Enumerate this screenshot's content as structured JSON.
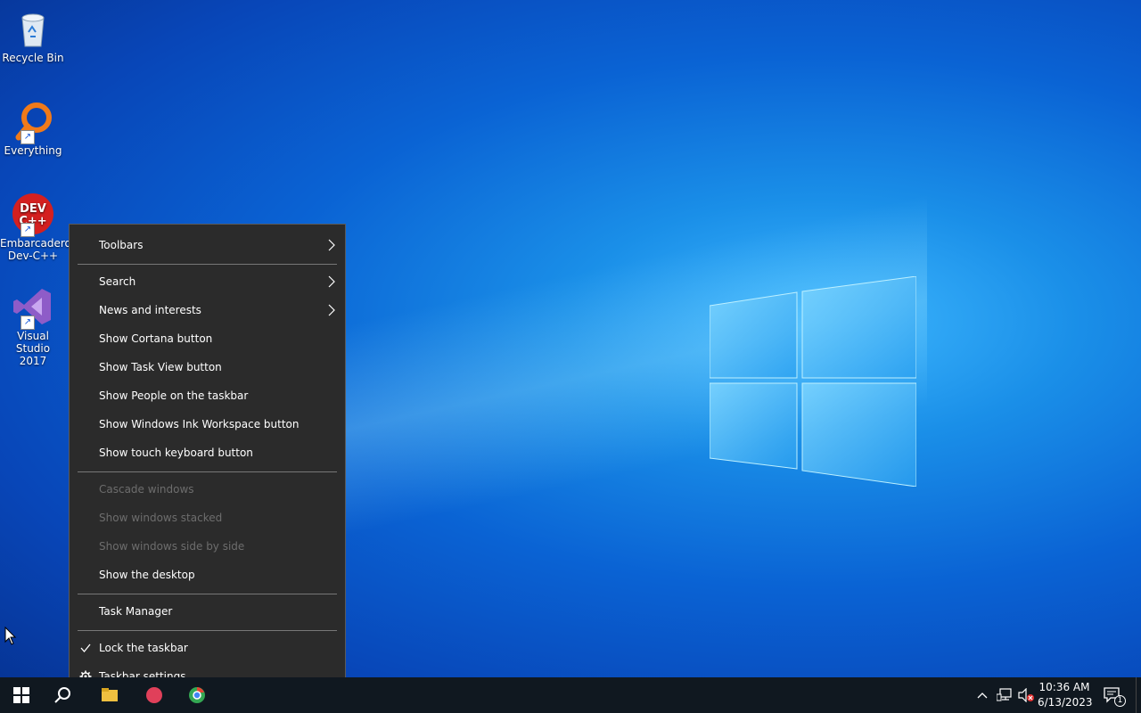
{
  "desktop_icons": [
    {
      "label": "Recycle Bin",
      "icon": "recycle-bin-icon"
    },
    {
      "label": "Everything",
      "icon": "everything-search-icon"
    },
    {
      "label_line1": "Embarcadero",
      "label_line2": "Dev-C++",
      "icon_text_1": "DEV",
      "icon_text_2": "C++",
      "icon": "dev-cpp-icon"
    },
    {
      "label_line1": "Visual Studio",
      "label_line2": "2017",
      "icon": "visual-studio-icon"
    }
  ],
  "context_menu": {
    "items": [
      {
        "label": "Toolbars",
        "submenu": true,
        "enabled": true
      },
      {
        "label": "Search",
        "submenu": true,
        "enabled": true
      },
      {
        "label": "News and interests",
        "submenu": true,
        "enabled": true
      },
      {
        "label": "Show Cortana button",
        "enabled": true
      },
      {
        "label": "Show Task View button",
        "enabled": true
      },
      {
        "label": "Show People on the taskbar",
        "enabled": true
      },
      {
        "label": "Show Windows Ink Workspace button",
        "enabled": true
      },
      {
        "label": "Show touch keyboard button",
        "enabled": true
      },
      {
        "label": "Cascade windows",
        "enabled": false
      },
      {
        "label": "Show windows stacked",
        "enabled": false
      },
      {
        "label": "Show windows side by side",
        "enabled": false
      },
      {
        "label": "Show the desktop",
        "enabled": true
      },
      {
        "label": "Task Manager",
        "enabled": true
      },
      {
        "label": "Lock the taskbar",
        "checked": true,
        "enabled": true
      },
      {
        "label": "Taskbar settings",
        "icon": "gear-icon",
        "enabled": true
      }
    ]
  },
  "taskbar": {
    "time": "10:36 AM",
    "date": "6/13/2023",
    "notification_count": "1",
    "start_icon": "windows-logo-icon",
    "search_icon": "search-icon"
  },
  "colors": {
    "menu_bg": "#2b2b2b",
    "menu_disabled_text": "#6d6d6d",
    "taskbar_bg": "#101820",
    "desktop_accent": "#0a63d4"
  }
}
